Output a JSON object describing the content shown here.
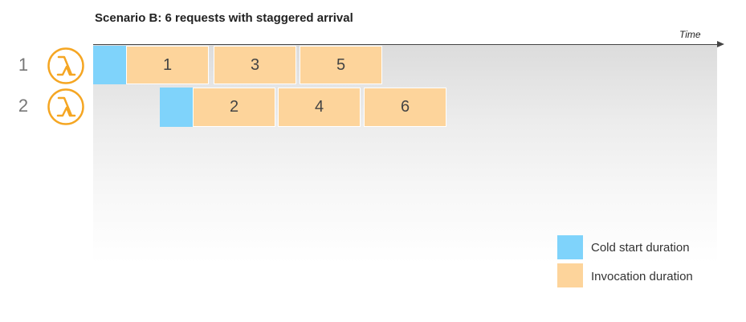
{
  "title": "Scenario B: 6 requests with staggered arrival",
  "axis": {
    "label": "Time"
  },
  "rows": [
    {
      "number": "1",
      "icon": "lambda-icon"
    },
    {
      "number": "2",
      "icon": "lambda-icon"
    }
  ],
  "timeline": {
    "row1": {
      "invocations": [
        "1",
        "3",
        "5"
      ]
    },
    "row2": {
      "invocations": [
        "2",
        "4",
        "6"
      ]
    }
  },
  "legend": {
    "cold_start": "Cold start duration",
    "invocation": "Invocation duration"
  },
  "colors": {
    "cold_start": "#7fd3fb",
    "invocation": "#fdd49b",
    "lambda_icon": "#f5a623"
  }
}
